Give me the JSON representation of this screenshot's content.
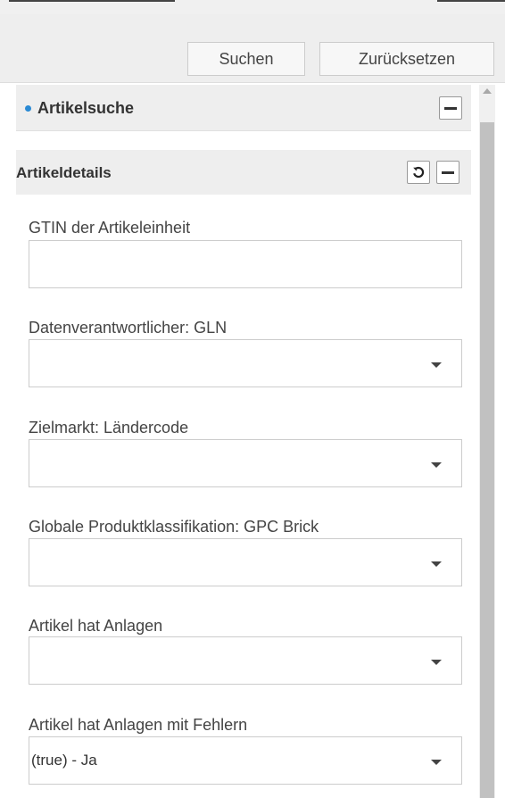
{
  "toolbar": {
    "search_label": "Suchen",
    "reset_label": "Zurücksetzen"
  },
  "search_section": {
    "title": "Artikelsuche",
    "bullet_color": "#2a8ad4"
  },
  "details": {
    "title": "Artikeldetails",
    "fields": [
      {
        "label": "GTIN der Artikeleinheit",
        "type": "text",
        "value": ""
      },
      {
        "label": "Datenverantwortlicher: GLN",
        "type": "select",
        "value": ""
      },
      {
        "label": "Zielmarkt: Ländercode",
        "type": "select",
        "value": ""
      },
      {
        "label": "Globale Produktklassifikation: GPC Brick",
        "type": "select",
        "value": ""
      },
      {
        "label": "Artikel hat Anlagen",
        "type": "select",
        "value": ""
      },
      {
        "label": "Artikel hat Anlagen mit Fehlern",
        "type": "select",
        "value": "(true) - Ja"
      }
    ]
  },
  "icons": {
    "collapse": "minus-icon",
    "reset": "refresh-icon",
    "dropdown": "chevron-down-icon"
  }
}
